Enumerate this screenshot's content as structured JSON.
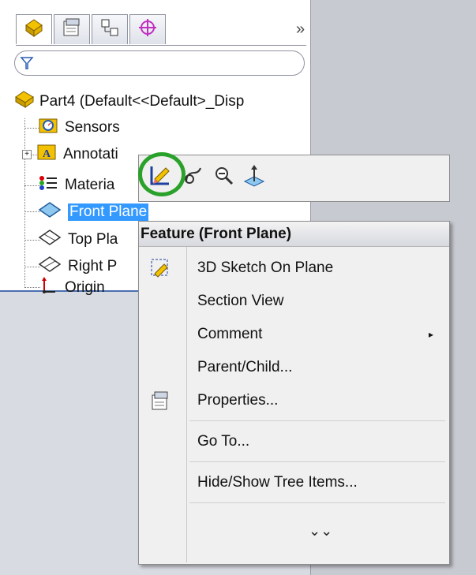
{
  "tabs": [
    {
      "icon": "feature-manager-icon"
    },
    {
      "icon": "property-manager-icon"
    },
    {
      "icon": "configuration-manager-icon"
    },
    {
      "icon": "dimxpert-manager-icon"
    }
  ],
  "tab_more": "»",
  "filter": {
    "icon": "filter-icon"
  },
  "tree": {
    "root": "Part4  (Default<<Default>_Disp",
    "items": [
      {
        "label": "Sensors",
        "icon": "sensors-icon"
      },
      {
        "label": "Annotati",
        "icon": "annotations-icon"
      },
      {
        "label": "Materia",
        "icon": "material-icon"
      },
      {
        "label": "Front Plane",
        "icon": "plane-icon"
      },
      {
        "label": "Top Pla",
        "icon": "plane-icon"
      },
      {
        "label": "Right P",
        "icon": "plane-icon"
      },
      {
        "label": "Origin",
        "icon": "origin-icon"
      }
    ]
  },
  "context_toolbar": {
    "icons": [
      "edit-sketch-icon",
      "edit-feature-icon",
      "zoom-to-selection-icon",
      "normal-to-icon"
    ],
    "highlight_color": "#2aa12a"
  },
  "menu": {
    "header": "Feature (Front Plane)",
    "items": [
      {
        "label": "3D Sketch On Plane",
        "icon": "sketch-3d-icon"
      },
      {
        "label": "Section View"
      },
      {
        "label": "Comment",
        "submenu": true
      },
      {
        "label": "Parent/Child..."
      },
      {
        "label": "Properties...",
        "icon": "properties-icon"
      },
      {
        "label": "Go To..."
      },
      {
        "label": "Hide/Show Tree Items..."
      }
    ],
    "more": "⌄⌄"
  },
  "colors": {
    "selection": "#3399ff",
    "accent_green": "#2aa12a"
  }
}
